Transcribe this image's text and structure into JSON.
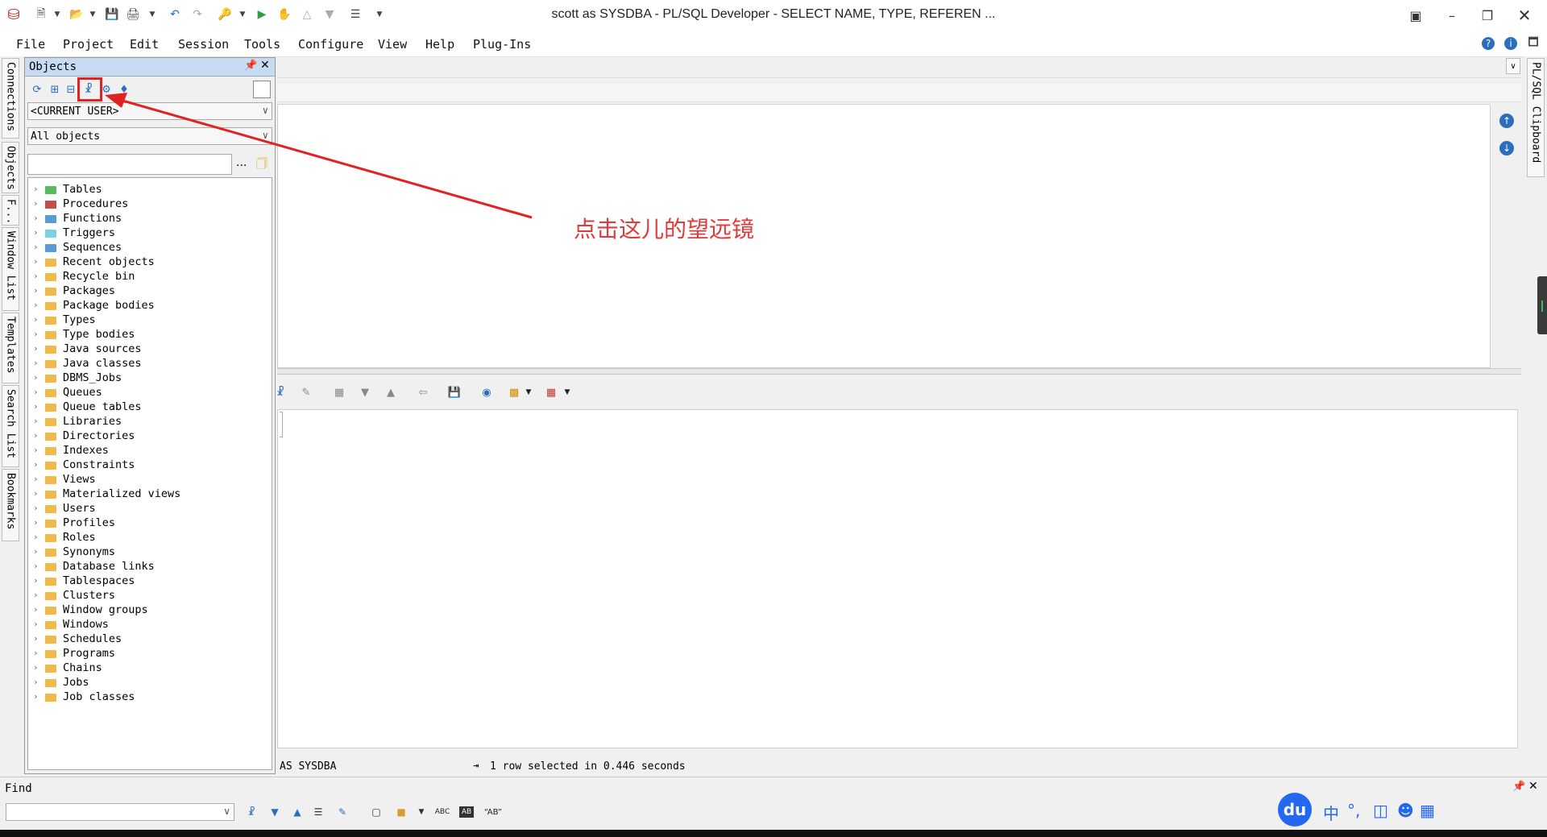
{
  "window": {
    "title": "scott as SYSDBA - PL/SQL Developer - SELECT NAME, TYPE, REFEREN ..."
  },
  "menu": [
    "File",
    "Project",
    "Edit",
    "Session",
    "Tools",
    "Configure",
    "View",
    "Help",
    "Plug-Ins"
  ],
  "left_dock": [
    "Connections",
    "Objects",
    "F...",
    "Window List",
    "Templates",
    "Search List",
    "Bookmarks"
  ],
  "right_dock": [
    "PL/SQL Clipboard"
  ],
  "objects_panel": {
    "title": "Objects",
    "user_combo": "<CURRENT USER>",
    "filter_combo": "All objects",
    "filter_input": "",
    "more_button": "...",
    "tree": [
      {
        "label": "Tables",
        "color": "#5cb85c"
      },
      {
        "label": "Procedures",
        "color": "#c0504d"
      },
      {
        "label": "Functions",
        "color": "#5b9bd5"
      },
      {
        "label": "Triggers",
        "color": "#7fd0e0"
      },
      {
        "label": "Sequences",
        "color": "#5b9bd5"
      },
      {
        "label": "Recent objects",
        "color": "#f0b94a"
      },
      {
        "label": "Recycle bin",
        "color": "#f0b94a"
      },
      {
        "label": "Packages",
        "color": "#f0b94a"
      },
      {
        "label": "Package bodies",
        "color": "#f0b94a"
      },
      {
        "label": "Types",
        "color": "#f0b94a"
      },
      {
        "label": "Type bodies",
        "color": "#f0b94a"
      },
      {
        "label": "Java sources",
        "color": "#f0b94a"
      },
      {
        "label": "Java classes",
        "color": "#f0b94a"
      },
      {
        "label": "DBMS_Jobs",
        "color": "#f0b94a"
      },
      {
        "label": "Queues",
        "color": "#f0b94a"
      },
      {
        "label": "Queue tables",
        "color": "#f0b94a"
      },
      {
        "label": "Libraries",
        "color": "#f0b94a"
      },
      {
        "label": "Directories",
        "color": "#f0b94a"
      },
      {
        "label": "Indexes",
        "color": "#f0b94a"
      },
      {
        "label": "Constraints",
        "color": "#f0b94a"
      },
      {
        "label": "Views",
        "color": "#f0b94a"
      },
      {
        "label": "Materialized views",
        "color": "#f0b94a"
      },
      {
        "label": "Users",
        "color": "#f0b94a"
      },
      {
        "label": "Profiles",
        "color": "#f0b94a"
      },
      {
        "label": "Roles",
        "color": "#f0b94a"
      },
      {
        "label": "Synonyms",
        "color": "#f0b94a"
      },
      {
        "label": "Database links",
        "color": "#f0b94a"
      },
      {
        "label": "Tablespaces",
        "color": "#f0b94a"
      },
      {
        "label": "Clusters",
        "color": "#f0b94a"
      },
      {
        "label": "Window groups",
        "color": "#f0b94a"
      },
      {
        "label": "Windows",
        "color": "#f0b94a"
      },
      {
        "label": "Schedules",
        "color": "#f0b94a"
      },
      {
        "label": "Programs",
        "color": "#f0b94a"
      },
      {
        "label": "Chains",
        "color": "#f0b94a"
      },
      {
        "label": "Jobs",
        "color": "#f0b94a"
      },
      {
        "label": "Job classes",
        "color": "#f0b94a"
      }
    ]
  },
  "status": {
    "session": "AS SYSDBA",
    "message": "1 row selected in 0.446 seconds"
  },
  "find": {
    "label": "Find",
    "value": "",
    "abc": "ABC",
    "ab": "AB"
  },
  "ime": {
    "logo": "du",
    "mode": "中",
    "punct": "°,"
  },
  "annotation": {
    "text": "点击这儿的望远镜",
    "color": "#e03a3a"
  }
}
